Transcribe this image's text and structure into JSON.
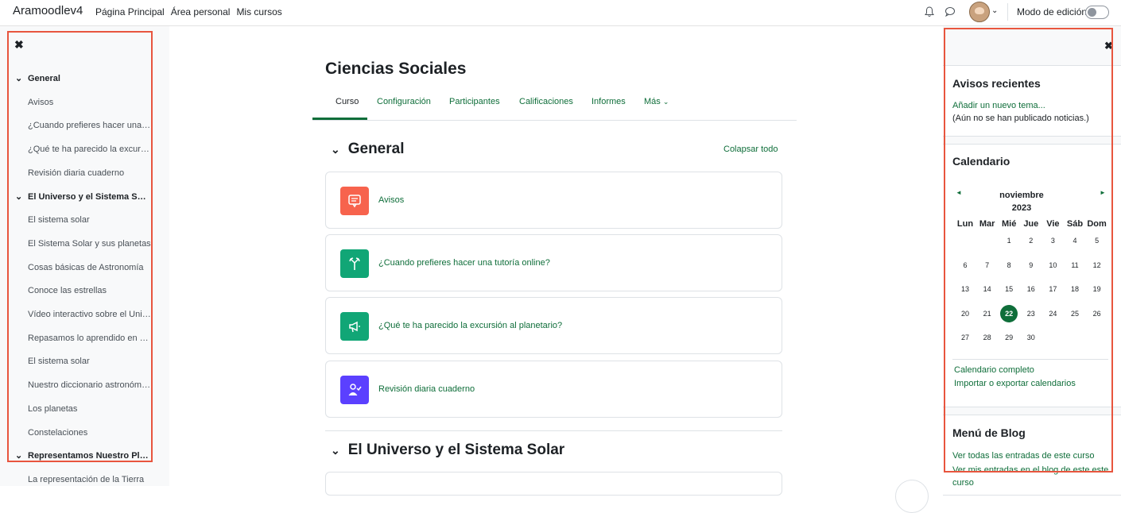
{
  "navbar": {
    "brand": "Aramoodlev4",
    "links": [
      "Página Principal",
      "Área personal",
      "Mis cursos"
    ],
    "edit_mode_label": "Modo de edición",
    "edit_mode": false,
    "icons": [
      "bell-icon",
      "chat-icon",
      "user-avatar",
      "chevron-down-icon"
    ]
  },
  "course_index": {
    "close_icon": "close-icon",
    "items": [
      {
        "type": "section",
        "label": "General"
      },
      {
        "type": "item",
        "label": "Avisos"
      },
      {
        "type": "item",
        "label": "¿Cuando prefieres hacer una tutoría online?"
      },
      {
        "type": "item",
        "label": "¿Qué te ha parecido la excursión al planetario?"
      },
      {
        "type": "item",
        "label": "Revisión diaria cuaderno"
      },
      {
        "type": "section",
        "label": "El Universo y el Sistema Solar"
      },
      {
        "type": "item",
        "label": "El sistema solar"
      },
      {
        "type": "item",
        "label": "El Sistema Solar y sus planetas"
      },
      {
        "type": "item",
        "label": "Cosas básicas de Astronomía"
      },
      {
        "type": "item",
        "label": "Conoce las estrellas"
      },
      {
        "type": "item",
        "label": "Vídeo interactivo sobre el Universo"
      },
      {
        "type": "item",
        "label": "Repasamos lo aprendido en clase"
      },
      {
        "type": "item",
        "label": "El sistema solar"
      },
      {
        "type": "item",
        "label": "Nuestro diccionario astronómico"
      },
      {
        "type": "item",
        "label": "Los planetas"
      },
      {
        "type": "item",
        "label": "Constelaciones"
      },
      {
        "type": "section",
        "label": "Representamos Nuestro Planeta"
      },
      {
        "type": "item",
        "label": "La representación de la Tierra"
      }
    ]
  },
  "main": {
    "title": "Ciencias Sociales",
    "tabs": [
      {
        "label": "Curso",
        "active": true
      },
      {
        "label": "Configuración",
        "active": false
      },
      {
        "label": "Participantes",
        "active": false
      },
      {
        "label": "Calificaciones",
        "active": false
      },
      {
        "label": "Informes",
        "active": false
      },
      {
        "label": "Más",
        "active": false
      }
    ],
    "collapse_all": "Colapsar todo",
    "sections": [
      {
        "title": "General"
      },
      {
        "title": "El Universo y el Sistema Solar"
      }
    ],
    "activities": [
      {
        "name": "Avisos",
        "icon": "forum-icon",
        "color": "#f7634d"
      },
      {
        "name": "¿Cuando prefieres hacer una tutoría online?",
        "icon": "choice-icon",
        "color": "#399be2"
      },
      {
        "name": "¿Qué te ha parecido la excursión al planetario?",
        "icon": "feedback-icon",
        "color": "#11a676"
      },
      {
        "name": "Revisión diaria cuaderno",
        "icon": "checklist-icon",
        "color": "#5b40ff"
      }
    ]
  },
  "blocks": {
    "close_icon": "close-icon",
    "news": {
      "title": "Avisos recientes",
      "add_link": "Añadir un nuevo tema...",
      "empty_text": "(Aún no se han publicado noticias.)"
    },
    "calendar": {
      "title": "Calendario",
      "month": "noviembre",
      "year": "2023",
      "weekdays": [
        "Lun",
        "Mar",
        "Mié",
        "Jue",
        "Vie",
        "Sáb",
        "Dom"
      ],
      "weeks": [
        [
          "",
          "",
          "1",
          "2",
          "3",
          "4",
          "5"
        ],
        [
          "6",
          "7",
          "8",
          "9",
          "10",
          "11",
          "12"
        ],
        [
          "13",
          "14",
          "15",
          "16",
          "17",
          "18",
          "19"
        ],
        [
          "20",
          "21",
          "22",
          "23",
          "24",
          "25",
          "26"
        ],
        [
          "27",
          "28",
          "29",
          "30",
          "",
          "",
          ""
        ]
      ],
      "today": "22",
      "full_link": "Calendario completo",
      "import_link": "Importar o exportar calendarios"
    },
    "blog": {
      "title": "Menú de Blog",
      "links": [
        "Ver todas las entradas de este curso",
        "Ver mis entradas en el blog de este este curso"
      ]
    }
  },
  "colors": {
    "accent": "#0f6e3a",
    "highlight_border": "#e8553e"
  }
}
